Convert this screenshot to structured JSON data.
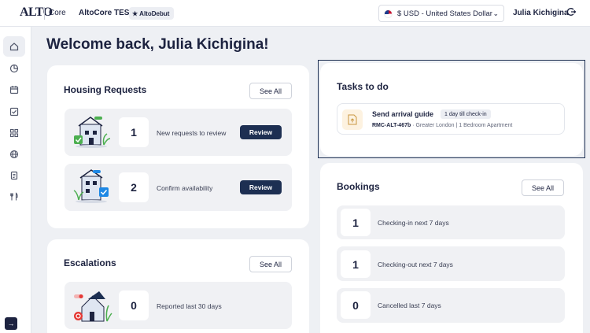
{
  "header": {
    "logo_text": "ALTO",
    "core_label": "Core",
    "app_name": "AltoCore TEST",
    "badge": "AltoDebut",
    "currency": "$ USD - United States Dollar",
    "user_name": "Julia Kichigina"
  },
  "sidebar": {
    "items": [
      "home",
      "analytics",
      "calendar",
      "tasks",
      "apps",
      "globe",
      "documents",
      "dining"
    ]
  },
  "welcome": "Welcome back, Julia Kichigina!",
  "housing": {
    "title": "Housing Requests",
    "see_all": "See All",
    "rows": [
      {
        "count": "1",
        "text": "New requests to review",
        "action": "Review"
      },
      {
        "count": "2",
        "text": "Confirm availability",
        "action": "Review"
      }
    ]
  },
  "escalations": {
    "title": "Escalations",
    "see_all": "See All",
    "rows": [
      {
        "count": "0",
        "text": "Reported last 30 days"
      }
    ]
  },
  "tasks": {
    "title": "Tasks to do",
    "items": [
      {
        "title": "Send arrival guide",
        "chip": "1 day till check-in",
        "ref": "RMC-ALT-467b",
        "detail": " · Greater London | 1 Bedroom Apartment"
      }
    ]
  },
  "bookings": {
    "title": "Bookings",
    "see_all": "See All",
    "rows": [
      {
        "count": "1",
        "text": "Checking-in next 7 days"
      },
      {
        "count": "1",
        "text": "Checking-out next 7 days"
      },
      {
        "count": "0",
        "text": "Cancelled last 7 days"
      }
    ]
  },
  "colors": {
    "navy": "#1d2f52",
    "accent_green": "#4caf50",
    "accent_blue": "#1e88e5"
  }
}
